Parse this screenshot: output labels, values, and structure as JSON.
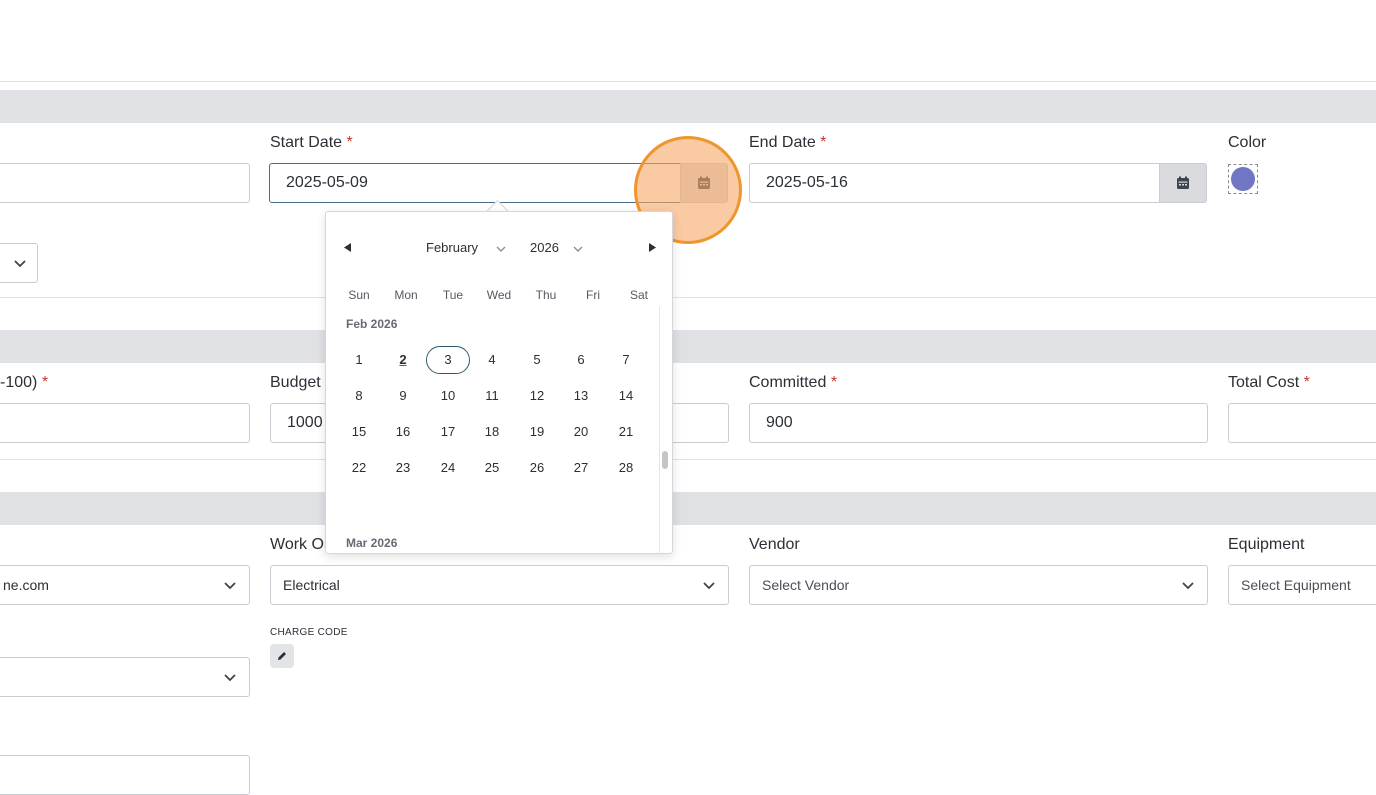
{
  "dates": {
    "start_label": "Start Date",
    "start_value": "2025-05-09",
    "end_label": "End Date",
    "end_value": "2025-05-16",
    "required_mark": "*"
  },
  "color": {
    "label": "Color",
    "value": "#7075c4"
  },
  "financial": {
    "percent_label_partial": "-100)",
    "budget_label": "Budget",
    "budget_value": "1000",
    "committed_label": "Committed",
    "committed_value": "900",
    "total_cost_label": "Total Cost"
  },
  "assignment": {
    "email_value_partial": "ne.com",
    "work_order_label_partial": "Work Or",
    "work_order_value": "Electrical",
    "vendor_label": "Vendor",
    "vendor_placeholder": "Select Vendor",
    "equipment_label": "Equipment",
    "equipment_placeholder": "Select Equipment",
    "charge_code_label": "CHARGE CODE"
  },
  "calendar": {
    "month": "February",
    "year": "2026",
    "weekdays": [
      "Sun",
      "Mon",
      "Tue",
      "Wed",
      "Thu",
      "Fri",
      "Sat"
    ],
    "month_heading": "Feb 2026",
    "next_month_heading": "Mar 2026",
    "weeks": [
      [
        "1",
        "2",
        "3",
        "4",
        "5",
        "6",
        "7"
      ],
      [
        "8",
        "9",
        "10",
        "11",
        "12",
        "13",
        "14"
      ],
      [
        "15",
        "16",
        "17",
        "18",
        "19",
        "20",
        "21"
      ],
      [
        "22",
        "23",
        "24",
        "25",
        "26",
        "27",
        "28"
      ]
    ],
    "today": "2",
    "selected": "3"
  },
  "icons": {
    "calendar": "calendar-icon",
    "chevron": "chevron-down-icon",
    "prev": "triangle-left-icon",
    "next": "triangle-right-icon",
    "edit": "pencil-icon"
  }
}
